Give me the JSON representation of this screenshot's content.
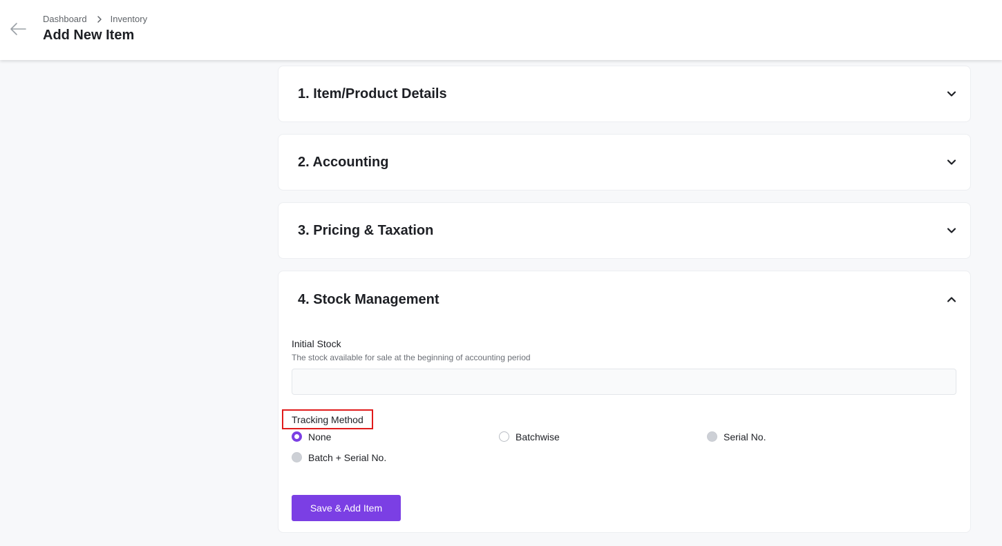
{
  "header": {
    "breadcrumb": [
      "Dashboard",
      "Inventory"
    ],
    "title": "Add New Item"
  },
  "sections": [
    {
      "title": "1. Item/Product Details",
      "expanded": false
    },
    {
      "title": "2. Accounting",
      "expanded": false
    },
    {
      "title": "3. Pricing & Taxation",
      "expanded": false
    },
    {
      "title": "4. Stock Management",
      "expanded": true
    }
  ],
  "stock": {
    "initial_stock_label": "Initial Stock",
    "initial_stock_help": "The stock available for sale at the beginning of accounting period",
    "initial_stock_value": "",
    "tracking_label": "Tracking Method",
    "tracking_options": [
      {
        "label": "None",
        "state": "checked"
      },
      {
        "label": "Batchwise",
        "state": "unchecked"
      },
      {
        "label": "Serial No.",
        "state": "disabled"
      },
      {
        "label": "Batch + Serial No.",
        "state": "disabled"
      }
    ],
    "save_label": "Save & Add Item"
  },
  "colors": {
    "accent": "#7b3fe4",
    "highlight_box": "#e01b1b"
  },
  "icons": {
    "back": "arrow-left-icon",
    "breadcrumb_separator": "chevron-right-icon",
    "collapsed": "chevron-down-icon",
    "expanded": "chevron-up-icon"
  }
}
